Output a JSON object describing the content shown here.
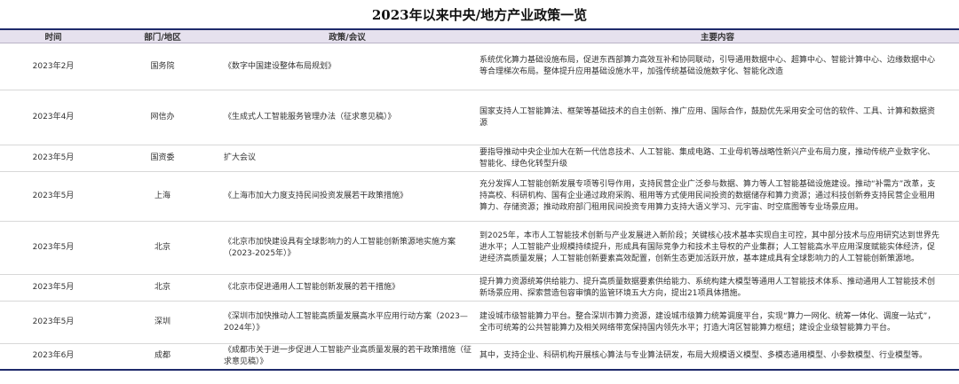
{
  "title": "2023年以来中央/地方产业政策一览",
  "headers": {
    "time": "时间",
    "dept": "部门/地区",
    "policy": "政策/会议",
    "content": "主要内容"
  },
  "rows": [
    {
      "time": "2023年2月",
      "dept": "国务院",
      "policy": "《数字中国建设整体布局规划》",
      "content": "系统优化算力基础设施布局，促进东西部算力高效互补和协同联动，引导通用数据中心、超算中心、智能计算中心、边缘数据中心等合理梯次布局。整体提升应用基础设施水平，加强传统基础设施数字化、智能化改造"
    },
    {
      "time": "2023年4月",
      "dept": "网信办",
      "policy": "《生成式人工智能服务管理办法（征求意见稿）》",
      "content": "国家支持人工智能算法、框架等基础技术的自主创新、推广应用、国际合作，鼓励优先采用安全可信的软件、工具、计算和数据资源"
    },
    {
      "time": "2023年5月",
      "dept": "国资委",
      "policy": "扩大会议",
      "content": "要指导推动中央企业加大在新一代信息技术、人工智能、集成电路、工业母机等战略性新兴产业布局力度，推动传统产业数字化、智能化、绿色化转型升级"
    },
    {
      "time": "2023年5月",
      "dept": "上海",
      "policy": "《上海市加大力度支持民间投资发展若干政策措施》",
      "content": "充分发挥人工智能创新发展专项等引导作用，支持民营企业广泛参与数据、算力等人工智能基础设施建设。推动“补需方”改革，支持高校、科研机构、国有企业通过政府采购、租用等方式使用民间投资的数据储存和算力资源；通过科技创新券支持民营企业租用算力、存储资源；推动政府部门租用民间投资专用算力支持大语义学习、元宇宙、时空底图等专业场景应用。"
    },
    {
      "time": "2023年5月",
      "dept": "北京",
      "policy": "《北京市加快建设具有全球影响力的人工智能创新策源地实施方案（2023-2025年）》",
      "content": "到2025年，本市人工智能技术创新与产业发展进入新阶段；关键核心技术基本实现自主可控，其中部分技术与应用研究达到世界先进水平；人工智能产业规模持续提升，形成具有国际竞争力和技术主导权的产业集群；人工智能高水平应用深度赋能实体经济，促进经济高质量发展；人工智能创新要素高效配置，创新生态更加活跃开放，基本建成具有全球影响力的人工智能创新策源地。"
    },
    {
      "time": "2023年5月",
      "dept": "北京",
      "policy": "《北京市促进通用人工智能创新发展的若干措施》",
      "content": "提升算力资源统筹供给能力、提升高质量数据要素供给能力、系统构建大模型等通用人工智能技术体系、推动通用人工智能技术创新场景应用、探索营造包容审慎的监管环境五大方向，提出21项具体措施。"
    },
    {
      "time": "2023年5月",
      "dept": "深圳",
      "policy": "《深圳市加快推动人工智能高质量发展高水平应用行动方案（2023—2024年）》",
      "content": "建设城市级智能算力平台。整合深圳市算力资源，建设城市级算力统筹调度平台，实现“算力一网化、统筹一体化、调度一站式”，全市可统筹的公共智能算力及相关网络带宽保持国内领先水平；打造大湾区智能算力枢纽；建设企业级智能算力平台。"
    },
    {
      "time": "2023年6月",
      "dept": "成都",
      "policy": "《成都市关于进一步促进人工智能产业高质量发展的若干政策措施（征求意见稿）》",
      "content": "其中，支持企业、科研机构开展核心算法与专业算法研发，布局大规模语义模型、多模态通用模型、小参数模型、行业模型等。"
    }
  ]
}
